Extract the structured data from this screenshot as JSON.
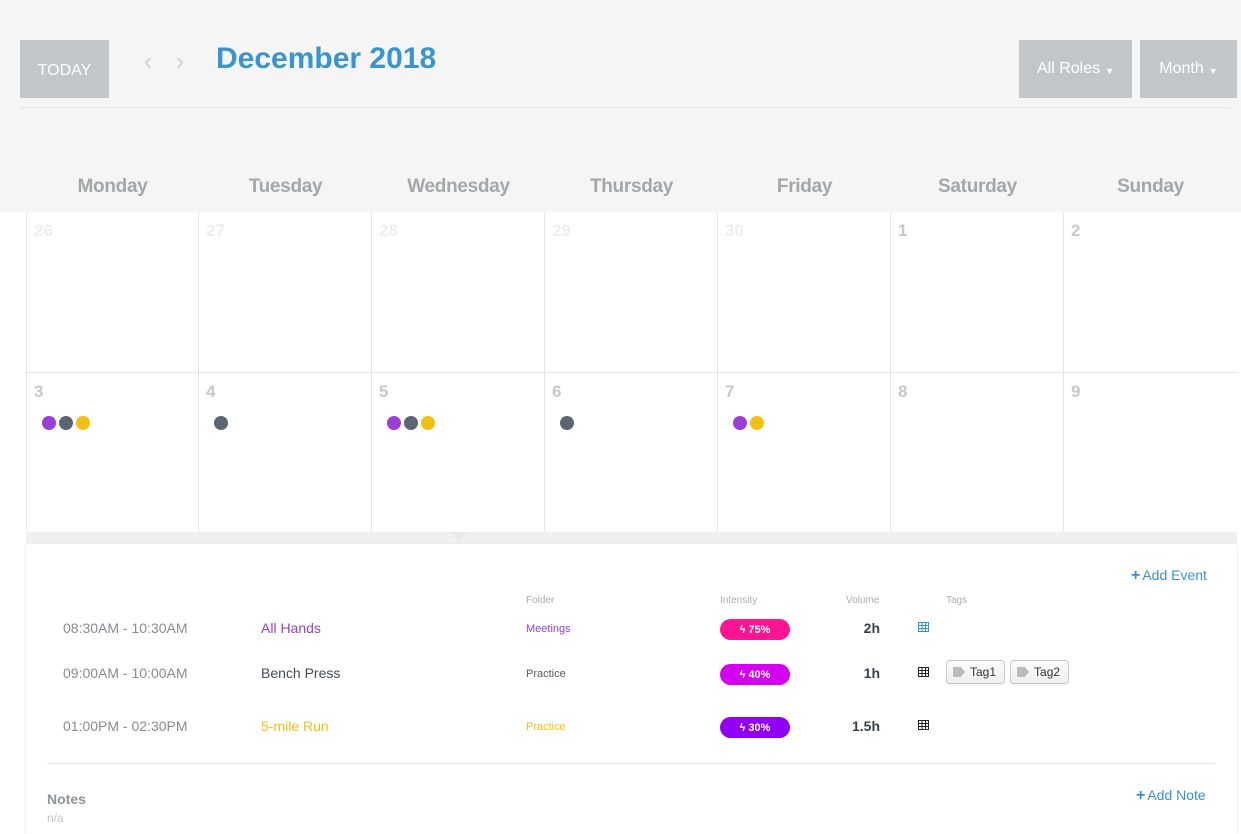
{
  "header": {
    "today_label": "TODAY",
    "prev_icon": "chevron-left-icon",
    "next_icon": "chevron-right-icon",
    "title": "December 2018",
    "roles_label": "All Roles",
    "view_label": "Month"
  },
  "colors": {
    "title": "#3a94d0",
    "purple": "#9b3fd4",
    "gray": "#5c6670",
    "yellow": "#f2c012",
    "intensity_pink": "#ff1493",
    "intensity_magenta": "#d400f0",
    "intensity_violet": "#8f00f5",
    "link": "#3a8fd0"
  },
  "day_names": [
    "Monday",
    "Tuesday",
    "Wednesday",
    "Thursday",
    "Friday",
    "Saturday",
    "Sunday"
  ],
  "weeks": [
    [
      {
        "num": "26",
        "muted": true,
        "dots": []
      },
      {
        "num": "27",
        "muted": true,
        "dots": []
      },
      {
        "num": "28",
        "muted": true,
        "dots": []
      },
      {
        "num": "29",
        "muted": true,
        "dots": []
      },
      {
        "num": "30",
        "muted": true,
        "dots": []
      },
      {
        "num": "1",
        "muted": false,
        "dots": []
      },
      {
        "num": "2",
        "muted": false,
        "dots": []
      }
    ],
    [
      {
        "num": "3",
        "muted": false,
        "dots": [
          "#9b3fd4",
          "#5c6670",
          "#f2c012"
        ]
      },
      {
        "num": "4",
        "muted": false,
        "dots": [
          "#5c6670"
        ]
      },
      {
        "num": "5",
        "muted": false,
        "dots": [
          "#9b3fd4",
          "#5c6670",
          "#f2c012"
        ]
      },
      {
        "num": "6",
        "muted": false,
        "dots": [
          "#5c6670"
        ]
      },
      {
        "num": "7",
        "muted": false,
        "dots": [
          "#9b3fd4",
          "#f2c012"
        ]
      },
      {
        "num": "8",
        "muted": false,
        "dots": []
      },
      {
        "num": "9",
        "muted": false,
        "dots": []
      }
    ]
  ],
  "panel": {
    "add_event_label": "Add Event",
    "add_note_label": "Add Note",
    "columns": {
      "folder": "Folder",
      "intensity": "Intensity",
      "volume": "Volume",
      "tags": "Tags"
    },
    "events": [
      {
        "time": "08:30AM - 10:30AM",
        "name": "All Hands",
        "name_color": "#9b3fd4",
        "folder": "Meetings",
        "folder_color": "#9b3fd4",
        "intensity": "75%",
        "intensity_color": "#ff1493",
        "volume": "2h",
        "sheet_color": "#3a8fd0",
        "tags": []
      },
      {
        "time": "09:00AM - 10:00AM",
        "name": "Bench Press",
        "name_color": "#444a50",
        "folder": "Practice",
        "folder_color": "#555b60",
        "intensity": "40%",
        "intensity_color": "#d400f0",
        "volume": "1h",
        "sheet_color": "#222222",
        "tags": [
          "Tag1",
          "Tag2"
        ]
      },
      {
        "time": "01:00PM - 02:30PM",
        "name": "5-mile Run",
        "name_color": "#f2c012",
        "folder": "Practice",
        "folder_color": "#f2c012",
        "intensity": "30%",
        "intensity_color": "#8f00f5",
        "volume": "1.5h",
        "sheet_color": "#222222",
        "tags": []
      }
    ],
    "notes_label": "Notes",
    "notes_value": "n/a"
  }
}
